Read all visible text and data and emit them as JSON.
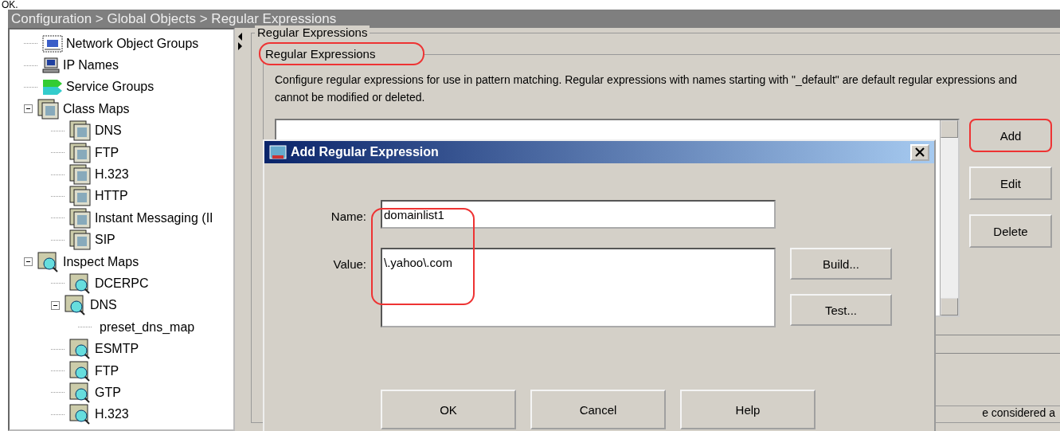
{
  "caption": "OK.",
  "breadcrumb": "Configuration > Global Objects > Regular Expressions",
  "tree": [
    {
      "label": "Network Object Groups",
      "kind": "network"
    },
    {
      "label": "IP Names",
      "kind": "computer"
    },
    {
      "label": "Service Groups",
      "kind": "service"
    },
    {
      "label": "Class Maps",
      "kind": "class",
      "expanded": true,
      "children": [
        {
          "label": "DNS",
          "kind": "class"
        },
        {
          "label": "FTP",
          "kind": "class"
        },
        {
          "label": "H.323",
          "kind": "class"
        },
        {
          "label": "HTTP",
          "kind": "class"
        },
        {
          "label": "Instant Messaging (II",
          "kind": "class"
        },
        {
          "label": "SIP",
          "kind": "class"
        }
      ]
    },
    {
      "label": "Inspect Maps",
      "kind": "inspect",
      "expanded": true,
      "children": [
        {
          "label": "DCERPC",
          "kind": "inspect"
        },
        {
          "label": "DNS",
          "kind": "inspect",
          "expanded": true,
          "children": [
            {
              "label": "preset_dns_map"
            }
          ]
        },
        {
          "label": "ESMTP",
          "kind": "inspect"
        },
        {
          "label": "FTP",
          "kind": "inspect"
        },
        {
          "label": "GTP",
          "kind": "inspect"
        },
        {
          "label": "H.323",
          "kind": "inspect"
        }
      ]
    }
  ],
  "panel": {
    "title": "Regular Expressions",
    "group": {
      "title": "Regular Expressions",
      "highlighted": true,
      "description": "Configure regular expressions for use in pattern matching. Regular expressions with names starting with \"_default\" are default regular expressions and cannot be modified or deleted."
    },
    "buttons": [
      {
        "label": "Add",
        "highlighted": true
      },
      {
        "label": "Edit",
        "highlighted": false
      },
      {
        "label": "Delete",
        "highlighted": false
      }
    ],
    "footer_text": "e considered a"
  },
  "dialog": {
    "title": "Add Regular Expression",
    "fields_highlighted": true,
    "fields": [
      {
        "label": "Name:",
        "value": "domainlist1",
        "kind": "line"
      },
      {
        "label": "Value:",
        "value": "\\.yahoo\\.com",
        "kind": "area"
      }
    ],
    "side_buttons": [
      "Build...",
      "Test..."
    ],
    "buttons": [
      "OK",
      "Cancel",
      "Help"
    ]
  }
}
